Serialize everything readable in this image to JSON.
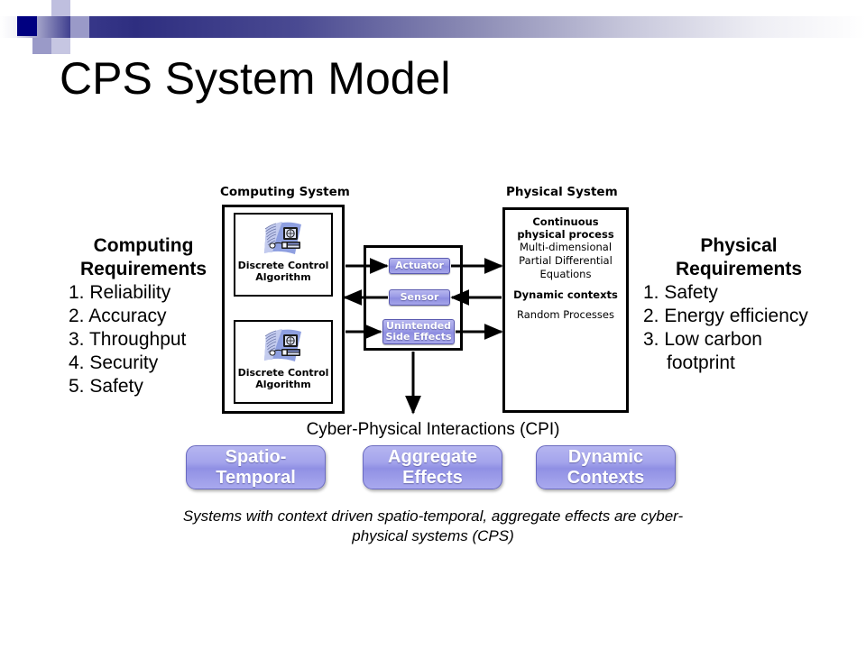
{
  "slide": {
    "title": "CPS System Model",
    "banner_dark_color": "#2e2e80",
    "accent_color": "#9a9ae6"
  },
  "diagram": {
    "computing_system_label": "Computing System",
    "physical_system_label": "Physical System",
    "cpi_label": "Cyber-Physical Interactions (CPI)",
    "computing_requirements": {
      "title_line1": "Computing",
      "title_line2": "Requirements",
      "items": [
        {
          "num": "1.",
          "text": "Reliability"
        },
        {
          "num": "2.",
          "text": "Accuracy"
        },
        {
          "num": "3.",
          "text": "Throughput"
        },
        {
          "num": "4.",
          "text": "Security"
        },
        {
          "num": "5.",
          "text": "Safety"
        }
      ]
    },
    "physical_requirements": {
      "title_line1": "Physical",
      "title_line2": "Requirements",
      "items": [
        {
          "num": "1.",
          "text": "Safety"
        },
        {
          "num": "2.",
          "text": "Energy efficiency"
        },
        {
          "num": "3.",
          "text": "Low carbon"
        },
        {
          "num": "",
          "text": "footprint"
        }
      ]
    },
    "control_cards": [
      {
        "line1": "Discrete Control",
        "line2": "Algorithm"
      },
      {
        "line1": "Discrete Control",
        "line2": "Algorithm"
      }
    ],
    "interface_chips": [
      {
        "line1": "Actuator",
        "line2": ""
      },
      {
        "line1": "Sensor",
        "line2": ""
      },
      {
        "line1": "Unintended",
        "line2": "Side Effects"
      }
    ],
    "physical_system": {
      "heading_line1": "Continuous",
      "heading_line2": "physical process",
      "detail_line1": "Multi-dimensional",
      "detail_line2": "Partial Differential",
      "detail_line3": "Equations",
      "heading2": "Dynamic contexts",
      "detail2": "Random Processes"
    },
    "cpi_chips": [
      {
        "line1": "Spatio-",
        "line2": "Temporal"
      },
      {
        "line1": "Aggregate",
        "line2": "Effects"
      },
      {
        "line1": "Dynamic",
        "line2": "Contexts"
      }
    ],
    "summary_line1": "Systems with context driven spatio-temporal, aggregate",
    "summary_line2": "effects are cyber-physical systems (CPS)"
  }
}
